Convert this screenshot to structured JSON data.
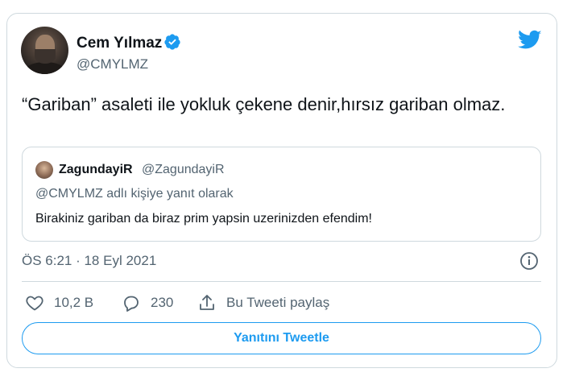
{
  "author": {
    "display_name": "Cem Yılmaz",
    "handle": "@CMYLMZ",
    "verified": true,
    "avatar": "profile-photo"
  },
  "tweet": {
    "text": "“Gariban” asaleti ile yokluk çekene denir,hırsız gariban olmaz.",
    "timestamp": "ÖS 6:21 · 18 Eyl 2021"
  },
  "quoted": {
    "display_name": "ZagundayiR",
    "handle": "@ZagundayiR",
    "reply_context": "@CMYLMZ adlı kişiye yanıt olarak",
    "text": "Birakiniz gariban da biraz prim yapsin uzerinizden efendim!"
  },
  "actions": {
    "like_count": "10,2 B",
    "reply_count": "230",
    "share_label": "Bu Tweeti paylaş"
  },
  "reply_button_label": "Yanıtını Tweetle",
  "icons": {
    "verified": "verified-badge-icon",
    "brand": "twitter-bird-icon",
    "info": "info-icon",
    "like": "heart-icon",
    "reply": "speech-bubble-icon",
    "share": "share-upload-icon"
  },
  "colors": {
    "accent": "#1d9bf0",
    "text": "#0f1419",
    "secondary_text": "#536471",
    "border": "#cfd9de"
  }
}
